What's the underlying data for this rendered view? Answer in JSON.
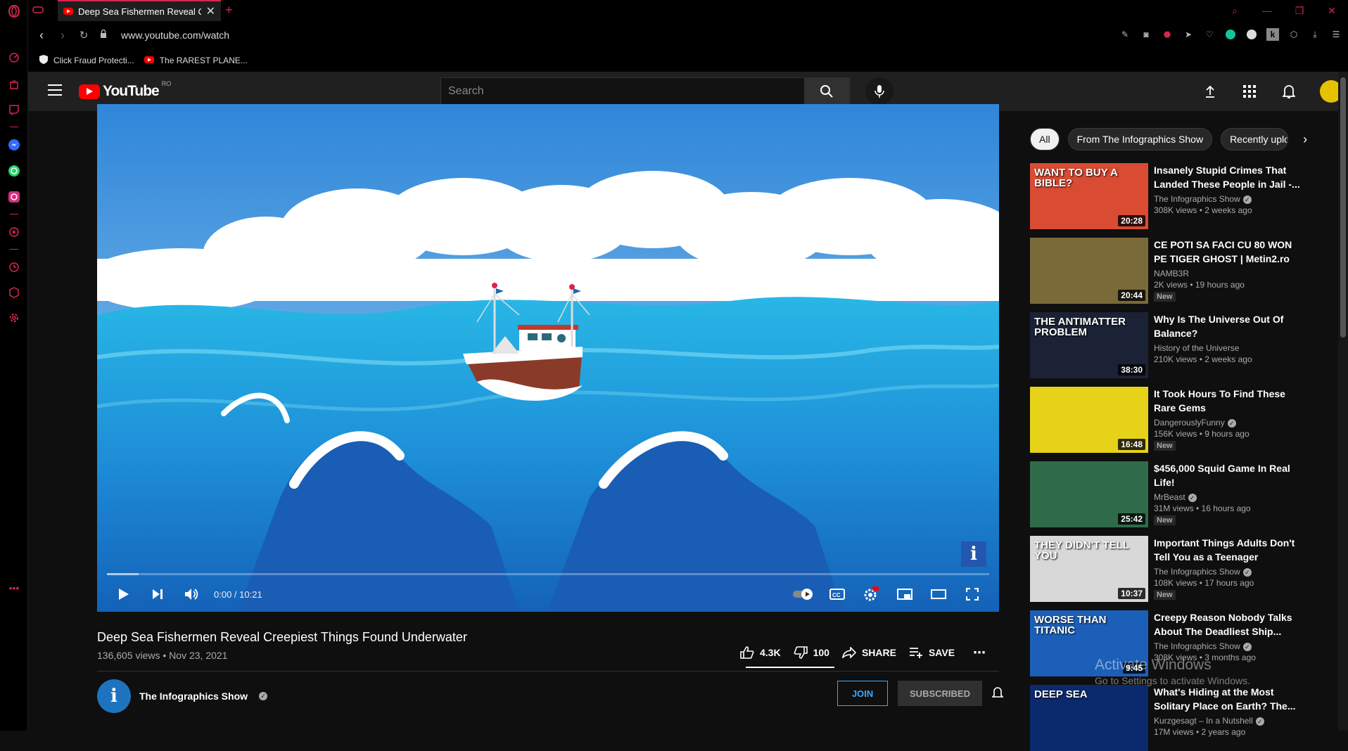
{
  "browser": {
    "tab_title": "Deep Sea Fishermen Reveal Creepiest Things Found Underwater",
    "url": "www.youtube.com/watch",
    "bookmarks": [
      "Click Fraud Protecti...",
      "The RAREST PLANE..."
    ],
    "accent": "#d9254d"
  },
  "youtube": {
    "logo_text": "YouTube",
    "country_code": "RO",
    "search_placeholder": "Search"
  },
  "player": {
    "time": "0:00 / 10:21",
    "progress": 0.0,
    "buffered": 0.036,
    "watermark": "i"
  },
  "video": {
    "title": "Deep Sea Fishermen Reveal Creepiest Things Found Underwater",
    "meta": "136,605 views • Nov 23, 2021",
    "likes": "4.3K",
    "dislikes": "100",
    "share_label": "SHARE",
    "save_label": "SAVE",
    "channel_name": "The Infographics Show",
    "join_label": "JOIN",
    "subscribed_label": "SUBSCRIBED"
  },
  "chips": [
    "All",
    "From The Infographics Show",
    "Recently uploaded"
  ],
  "recommendations": [
    {
      "title": "Insanely Stupid Crimes That Landed These People in Jail -...",
      "channel": "The Infographics Show",
      "verified": true,
      "views": "308K views • 2 weeks ago",
      "duration": "20:28",
      "new": false,
      "overlay": "WANT TO BUY A BIBLE?",
      "color": "#d94b32"
    },
    {
      "title": "CE POTI SA FACI CU 80 WON PE TIGER GHOST | Metin2.ro",
      "channel": "NAMB3R",
      "verified": false,
      "views": "2K views • 19 hours ago",
      "duration": "20:44",
      "new": true,
      "overlay": "",
      "color": "#7a6a3a"
    },
    {
      "title": "Why Is The Universe Out Of Balance?",
      "channel": "History of the Universe",
      "verified": false,
      "views": "210K views • 2 weeks ago",
      "duration": "38:30",
      "new": false,
      "overlay": "THE ANTIMATTER PROBLEM",
      "color": "#1b2236"
    },
    {
      "title": "It Took Hours To Find These Rare Gems",
      "channel": "DangerouslyFunny",
      "verified": true,
      "views": "156K views • 9 hours ago",
      "duration": "16:48",
      "new": true,
      "overlay": "",
      "color": "#e7d21a"
    },
    {
      "title": "$456,000 Squid Game In Real Life!",
      "channel": "MrBeast",
      "verified": true,
      "views": "31M views • 16 hours ago",
      "duration": "25:42",
      "new": true,
      "overlay": "",
      "color": "#2f6b4a"
    },
    {
      "title": "Important Things Adults Don't Tell You as a Teenager",
      "channel": "The Infographics Show",
      "verified": true,
      "views": "108K views • 17 hours ago",
      "duration": "10:37",
      "new": true,
      "overlay": "THEY DIDN'T TELL YOU",
      "color": "#d8d8d8"
    },
    {
      "title": "Creepy Reason Nobody Talks About The Deadliest Ship...",
      "channel": "The Infographics Show",
      "verified": true,
      "views": "308K views • 3 months ago",
      "duration": "9:45",
      "new": false,
      "overlay": "WORSE THAN TITANIC",
      "color": "#1c5fb8"
    },
    {
      "title": "What's Hiding at the Most Solitary Place on Earth? The...",
      "channel": "Kurzgesagt – In a Nutshell",
      "verified": true,
      "views": "17M views • 2 years ago",
      "duration": "",
      "new": false,
      "overlay": "DEEP SEA",
      "color": "#0b2a6e"
    }
  ],
  "windows_watermark": {
    "line1": "Activate Windows",
    "line2": "Go to Settings to activate Windows."
  }
}
